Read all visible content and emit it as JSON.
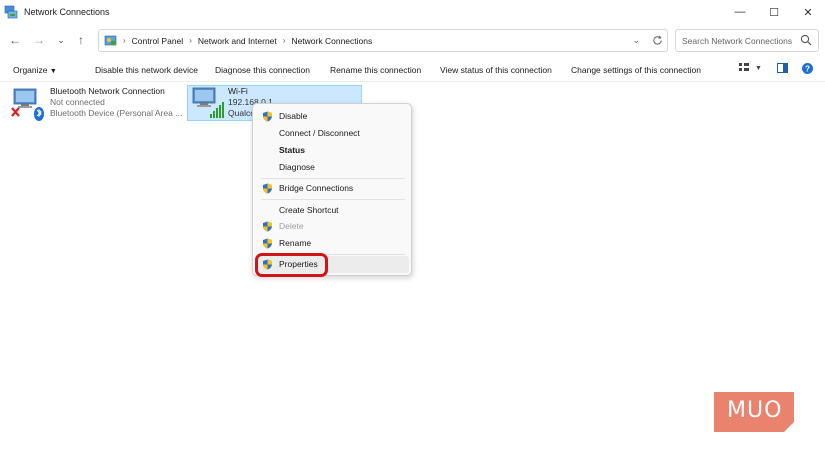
{
  "window": {
    "title": "Network Connections",
    "controls": {
      "minimize": "—",
      "maximize": "☐",
      "close": "✕"
    }
  },
  "nav": {
    "back": "←",
    "forward": "→",
    "recent": "⌄",
    "up": "↑"
  },
  "breadcrumb": [
    "Control Panel",
    "Network and Internet",
    "Network Connections"
  ],
  "search": {
    "placeholder": "Search Network Connections"
  },
  "toolbar": {
    "organize": "Organize",
    "disable_device": "Disable this network device",
    "diagnose": "Diagnose this connection",
    "rename": "Rename this connection",
    "view_status": "View status of this connection",
    "change_settings": "Change settings of this connection"
  },
  "connections": [
    {
      "name": "Bluetooth Network Connection",
      "status": "Not connected",
      "device": "Bluetooth Device (Personal Area ..."
    },
    {
      "name": "Wi-Fi",
      "status": "192.168.0.1",
      "device": "Qualco"
    }
  ],
  "context_menu": {
    "items": [
      {
        "label": "Disable",
        "shield": true
      },
      {
        "label": "Connect / Disconnect",
        "shield": false
      },
      {
        "label": "Status",
        "shield": false,
        "bold": true
      },
      {
        "label": "Diagnose",
        "shield": false
      },
      {
        "label": "Bridge Connections",
        "shield": true
      },
      {
        "label": "Create Shortcut",
        "shield": false
      },
      {
        "label": "Delete",
        "shield": true,
        "disabled": true
      },
      {
        "label": "Rename",
        "shield": true
      },
      {
        "label": "Properties",
        "shield": true,
        "highlighted": true
      }
    ]
  },
  "watermark": {
    "text": "MUO"
  },
  "colors": {
    "selection_bg": "#cce8ff",
    "selection_border": "#99d1ff",
    "highlight_ring": "#d0141a",
    "watermark": "#e8755e"
  }
}
